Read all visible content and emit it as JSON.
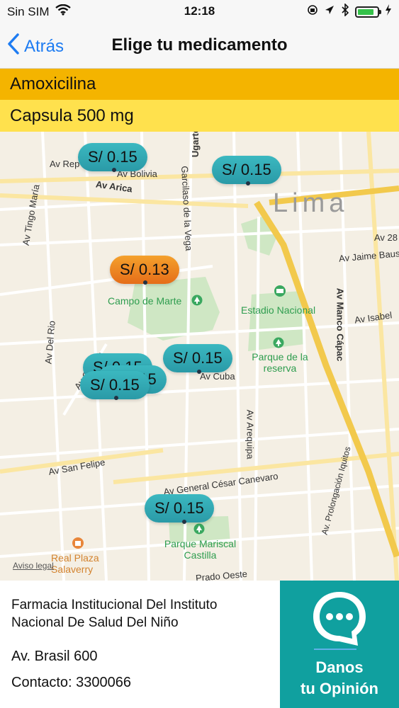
{
  "status": {
    "carrier": "Sin SIM",
    "time": "12:18",
    "battery_level": 0.85
  },
  "nav": {
    "back": "Atrás",
    "title": "Elige tu medicamento"
  },
  "medicine": {
    "name": "Amoxicilina",
    "dose": "Capsula 500 mg"
  },
  "map": {
    "labels": {
      "lima": "Lima",
      "av_arica": "Av Arica",
      "av_bolivia": "Av Bolivia",
      "av_rep": "Av Rep",
      "ugarte": "Ugarte",
      "garcilaso": "Garcilaso de la Vega",
      "av_jaime": "Av Jaime Baus",
      "av_manco": "Av Manco Cápac",
      "av_isabel": "Av Isabel",
      "av_cuba": "Av Cuba",
      "av_del_rio": "Av Del Rio",
      "av_san_felipe": "Av San Felipe",
      "av_general": "Av General César Canevaro",
      "av_arequipa": "Av Arequipa",
      "av_quinto": "Av. Prolongación Iquitos",
      "av_tingo": "Av Tingo María",
      "av_garzon": "Av Garzon",
      "av_28": "Av 28",
      "prado": "Prado Oeste",
      "campo": "Campo de Marte",
      "estadio": "Estadio Nacional",
      "parque_reserva": "Parque de la reserva",
      "parque_mariscal": "Parque Mariscal Castilla",
      "real_plaza": "Real Plaza Salaverry",
      "aviso": "Aviso legal"
    },
    "pins": [
      {
        "price": "S/ 0.15",
        "color": "teal"
      },
      {
        "price": "S/ 0.15",
        "color": "teal"
      },
      {
        "price": "S/ 0.13",
        "color": "orange"
      },
      {
        "price": "S/ 0.15",
        "color": "teal"
      },
      {
        "price": "S/ 0.15",
        "color": "teal"
      },
      {
        "price": "S/ 0.15",
        "color": "teal"
      },
      {
        "price": "S/ 0.15",
        "color": "teal"
      }
    ]
  },
  "pharmacy": {
    "name": "Farmacia Institucional Del Instituto Nacional De Salud Del Niño",
    "address": "Av. Brasil 600",
    "contact": "Contacto: 3300066"
  },
  "feedback": {
    "line1": "Danos",
    "line2": "tu Opinión"
  },
  "colors": {
    "accent": "#1e7cf2",
    "amber": "#f4b400",
    "yellow": "#ffe14d",
    "teal": "#10a09f"
  }
}
